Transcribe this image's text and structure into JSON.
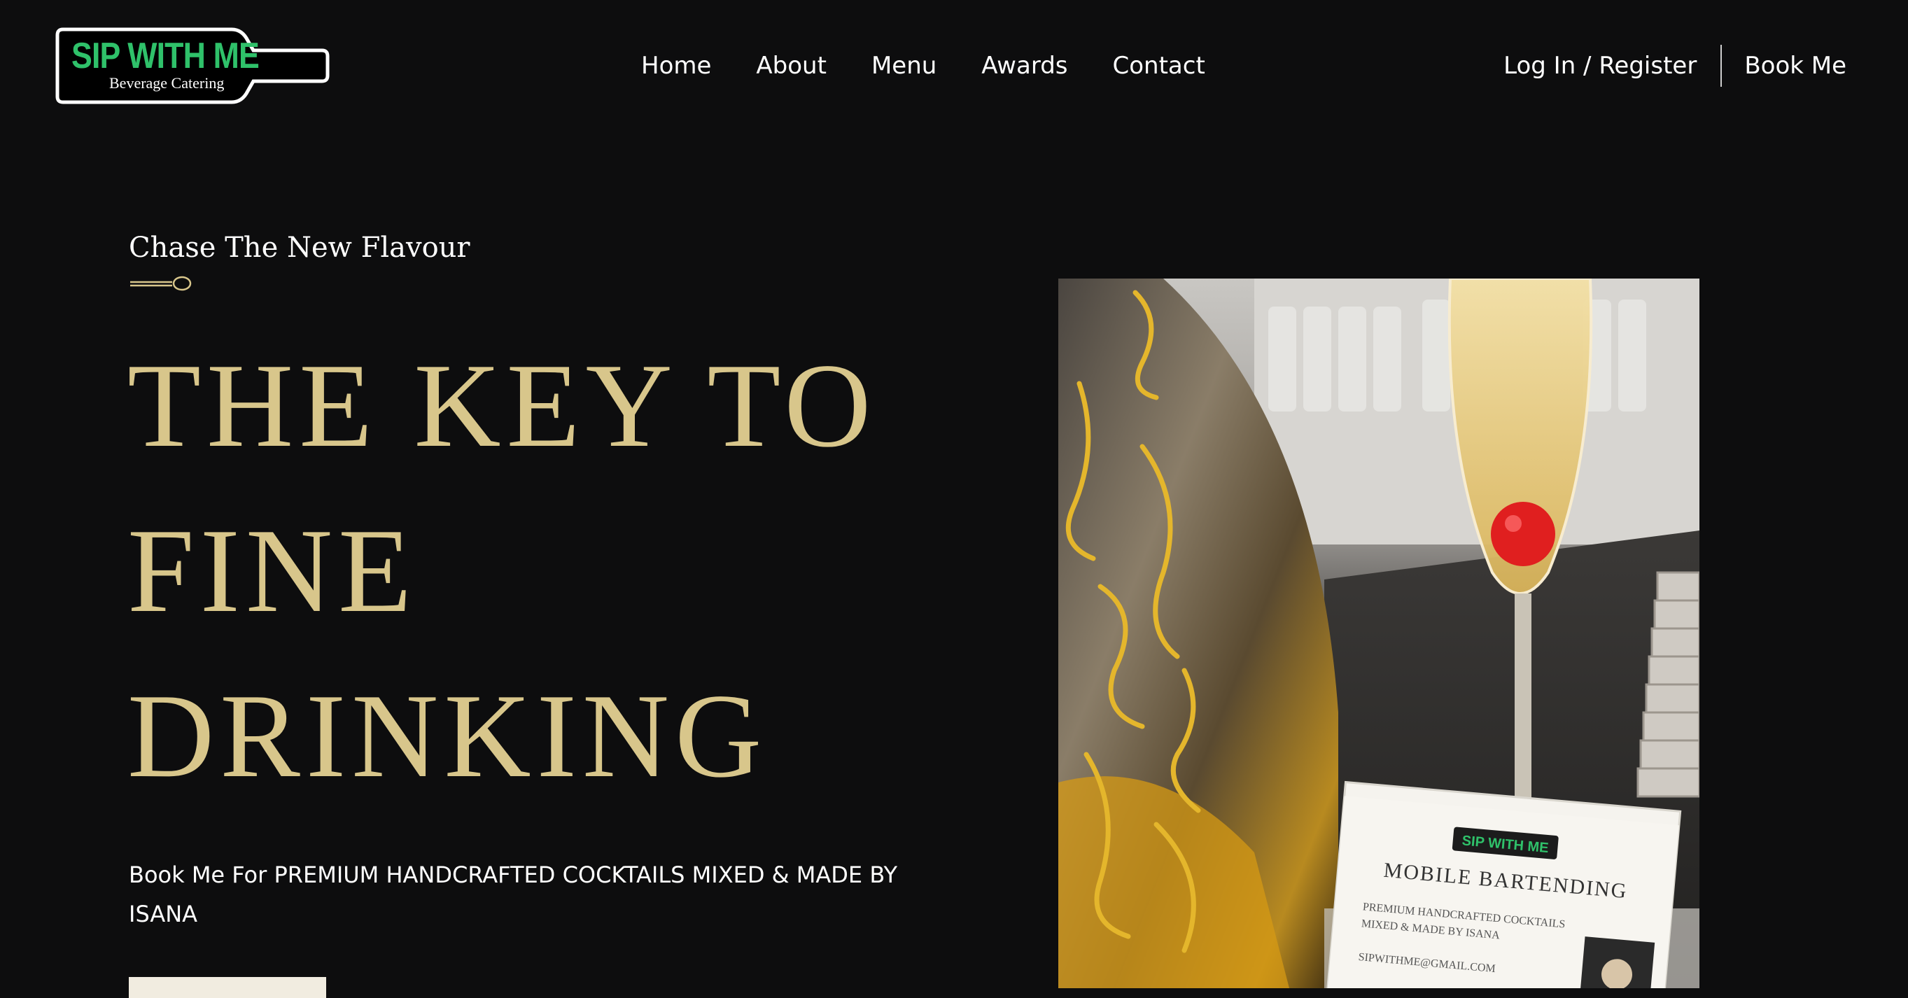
{
  "header": {
    "logo": {
      "title": "SIP WITH ME",
      "subtitle": "Beverage Catering"
    },
    "nav": [
      {
        "label": "Home"
      },
      {
        "label": "About"
      },
      {
        "label": "Menu"
      },
      {
        "label": "Awards"
      },
      {
        "label": "Contact"
      }
    ],
    "login_label": "Log In / Register",
    "book_label": "Book Me"
  },
  "hero": {
    "tagline": "Chase The New Flavour",
    "headline_lines": [
      "THE KEY TO",
      "FINE",
      "DRINKING"
    ],
    "subcopy": "Book Me For PREMIUM HANDCRAFTED COCKTAILS MIXED & MADE BY ISANA",
    "photo": {
      "card_title": "MOBILE BARTENDING",
      "card_logo": "SIP WITH ME",
      "card_line1": "PREMIUM HANDCRAFTED COCKTAILS",
      "card_line2": "MIXED & MADE BY ISANA",
      "card_email": "SIPWITHME@GMAIL.COM"
    }
  },
  "colors": {
    "background": "#0d0d0e",
    "gold": "#d8c68b",
    "logo_green": "#2fc16a",
    "button": "#f1ece0"
  }
}
